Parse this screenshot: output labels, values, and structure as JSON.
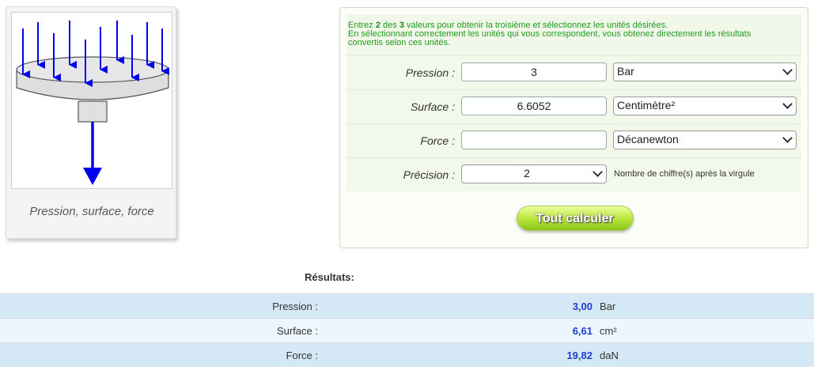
{
  "illustration": {
    "caption": "Pression, surface, force",
    "icon": "pressure-force-diagram-icon"
  },
  "form": {
    "intro_line1_pre": "Entrez ",
    "intro_line1_n1": "2",
    "intro_line1_mid": " des ",
    "intro_line1_n2": "3",
    "intro_line1_post": " valeurs pour obtenir la troisième et sélectionnez les unités désirées.",
    "intro_line2": "En sélectionnant correctement les unités qui vous correspondent, vous obtenez directement les résultats",
    "intro_line3": "convertis selon ces unités.",
    "pressure": {
      "label": "Pression :",
      "value": "3",
      "unit": "Bar"
    },
    "surface": {
      "label": "Surface :",
      "value": "6.6052",
      "unit": "Centimètre²"
    },
    "force": {
      "label": "Force :",
      "value": "",
      "unit": "Décanewton"
    },
    "precision": {
      "label": "Précision :",
      "value": "2",
      "hint": "Nombre de chiffre(s) après la virgule"
    },
    "calculate_label": "Tout calculer"
  },
  "results": {
    "title": "Résultats:",
    "rows": [
      {
        "label": "Pression :",
        "value": "3,00",
        "unit": "Bar"
      },
      {
        "label": "Surface :",
        "value": "6,61",
        "unit": "cm²"
      },
      {
        "label": "Force :",
        "value": "19,82",
        "unit": "daN"
      }
    ]
  }
}
